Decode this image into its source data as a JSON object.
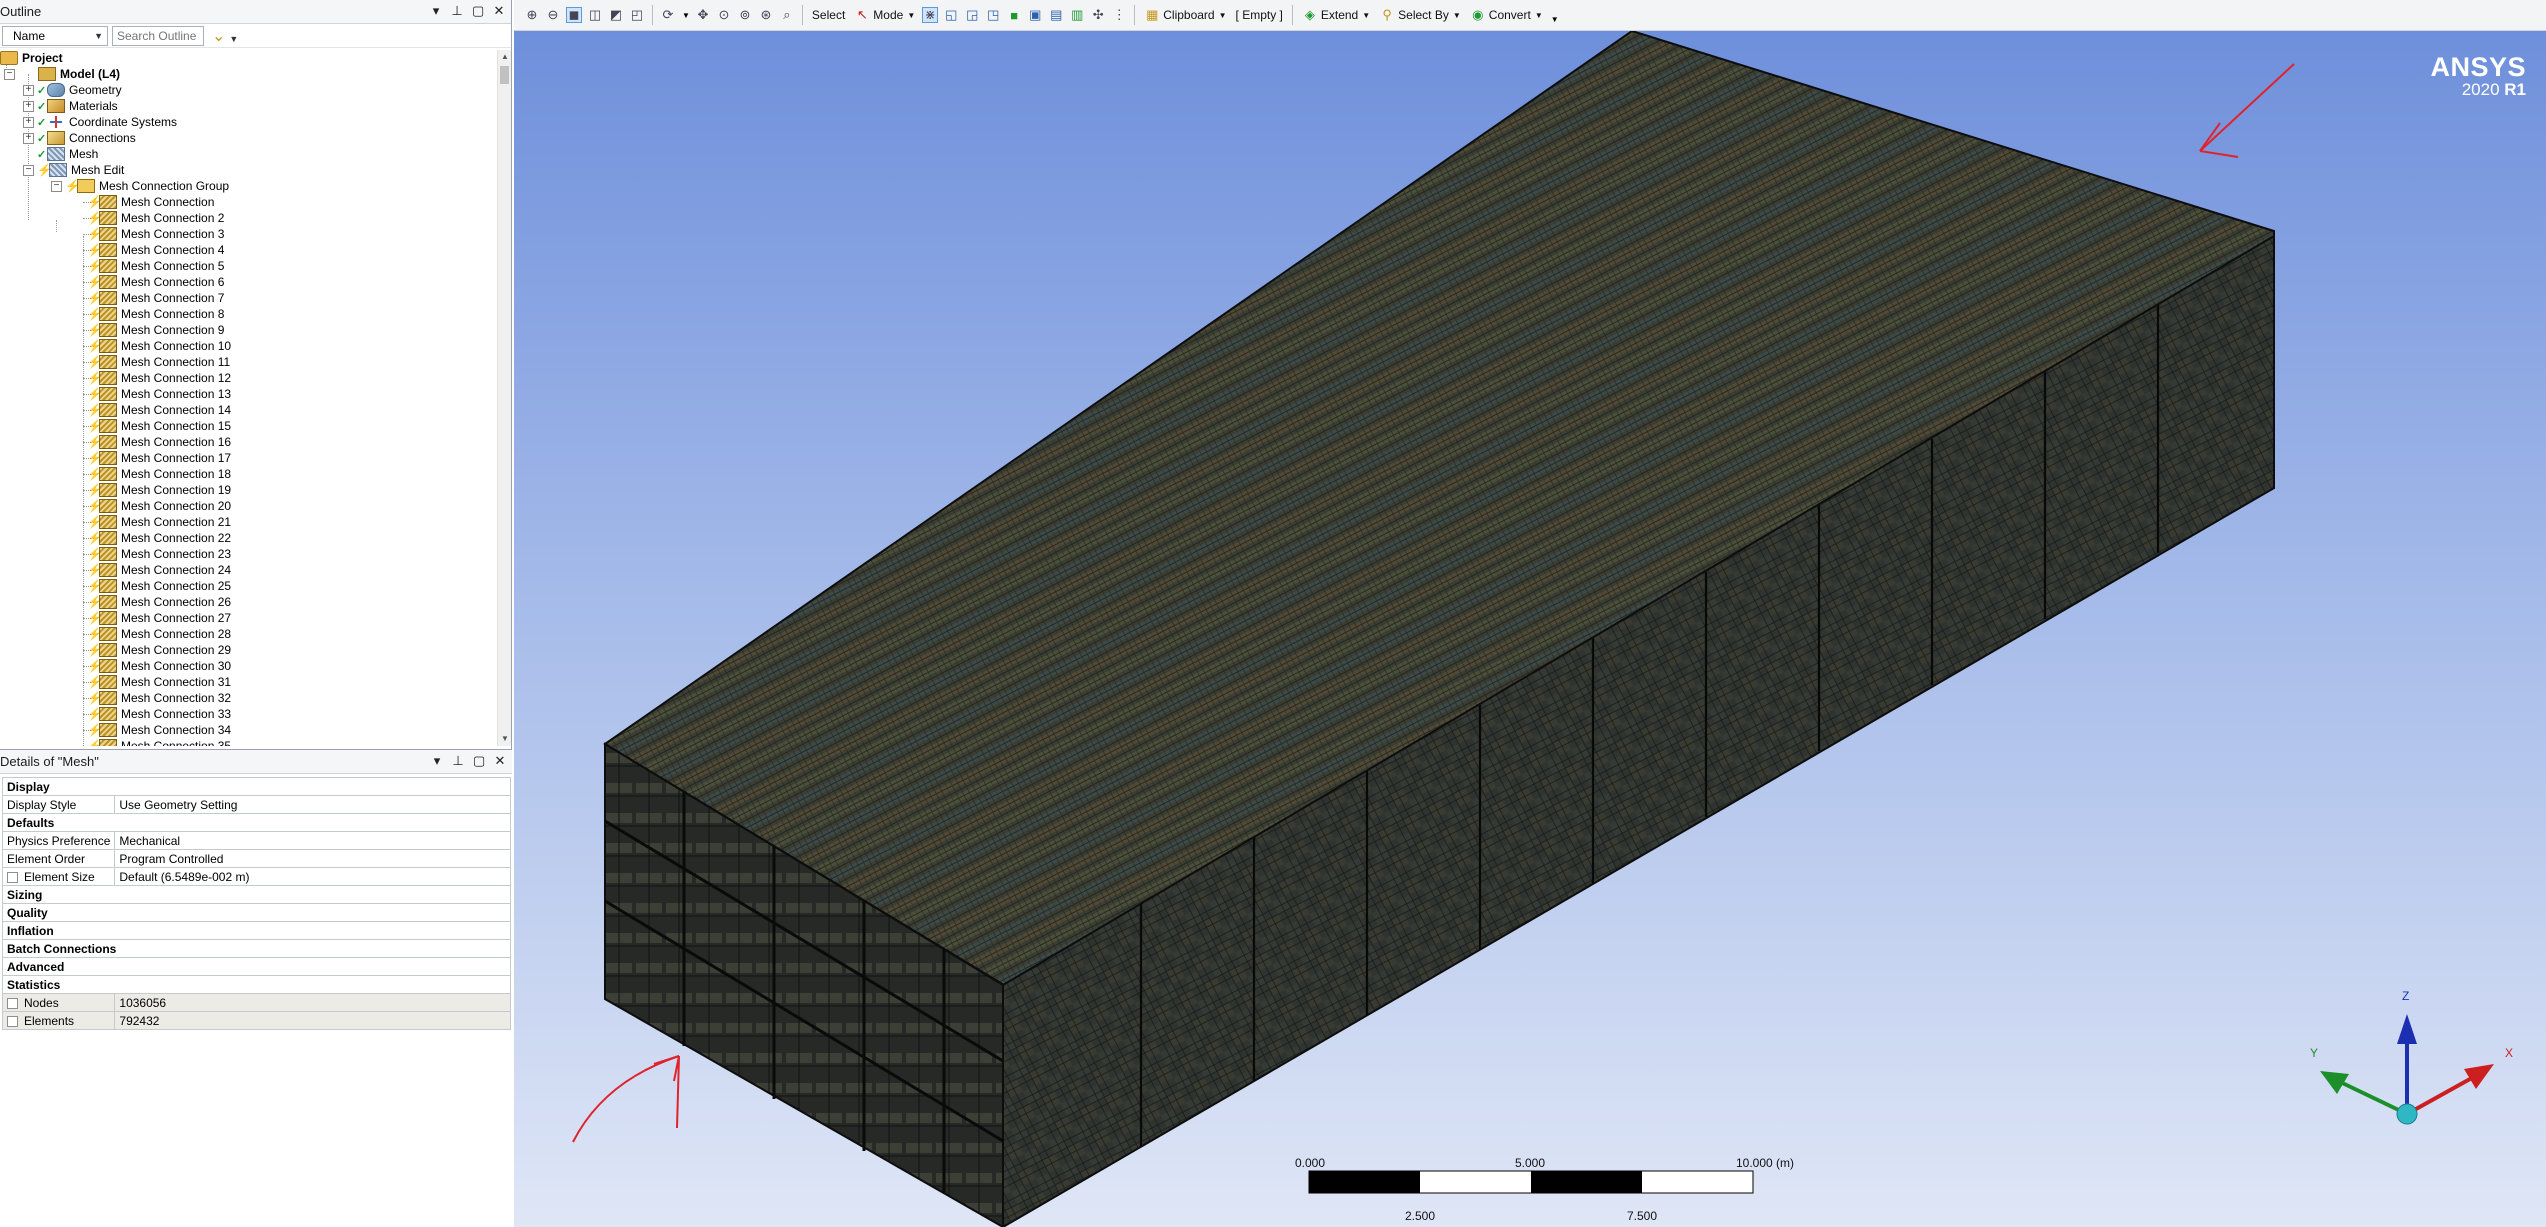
{
  "outline": {
    "title": "Outline",
    "filter_select": "Name",
    "search_placeholder": "Search Outline",
    "tree": {
      "project": "Project",
      "model": "Model (L4)",
      "geometry": "Geometry",
      "materials": "Materials",
      "coordinate_systems": "Coordinate Systems",
      "connections": "Connections",
      "mesh": "Mesh",
      "mesh_edit": "Mesh Edit",
      "mesh_connection_group": "Mesh Connection Group",
      "mesh_connections": [
        "Mesh Connection",
        "Mesh Connection 2",
        "Mesh Connection 3",
        "Mesh Connection 4",
        "Mesh Connection 5",
        "Mesh Connection 6",
        "Mesh Connection 7",
        "Mesh Connection 8",
        "Mesh Connection 9",
        "Mesh Connection 10",
        "Mesh Connection 11",
        "Mesh Connection 12",
        "Mesh Connection 13",
        "Mesh Connection 14",
        "Mesh Connection 15",
        "Mesh Connection 16",
        "Mesh Connection 17",
        "Mesh Connection 18",
        "Mesh Connection 19",
        "Mesh Connection 20",
        "Mesh Connection 21",
        "Mesh Connection 22",
        "Mesh Connection 23",
        "Mesh Connection 24",
        "Mesh Connection 25",
        "Mesh Connection 26",
        "Mesh Connection 27",
        "Mesh Connection 28",
        "Mesh Connection 29",
        "Mesh Connection 30",
        "Mesh Connection 31",
        "Mesh Connection 32",
        "Mesh Connection 33",
        "Mesh Connection 34",
        "Mesh Connection 35"
      ]
    }
  },
  "details": {
    "title": "Details of \"Mesh\"",
    "display_cat": "Display",
    "display_style_key": "Display Style",
    "display_style_val": "Use Geometry Setting",
    "defaults_cat": "Defaults",
    "physics_key": "Physics Preference",
    "physics_val": "Mechanical",
    "order_key": "Element Order",
    "order_val": "Program Controlled",
    "size_key": "Element Size",
    "size_val": "Default (6.5489e-002 m)",
    "sizing_cat": "Sizing",
    "quality_cat": "Quality",
    "inflation_cat": "Inflation",
    "batch_cat": "Batch Connections",
    "advanced_cat": "Advanced",
    "statistics_cat": "Statistics",
    "nodes_key": "Nodes",
    "nodes_val": "1036056",
    "elements_key": "Elements",
    "elements_val": "792432"
  },
  "toolbar": {
    "select": "Select",
    "mode": "Mode",
    "clipboard": "Clipboard",
    "empty": "[ Empty ]",
    "extend": "Extend",
    "select_by": "Select By",
    "convert": "Convert"
  },
  "viewport": {
    "brand_name": "ANSYS",
    "brand_version": "2020",
    "brand_release": "R1",
    "scale_labels_top": [
      "0.000",
      "5.000",
      "10.000 (m)"
    ],
    "scale_labels_bottom": [
      "2.500",
      "7.500"
    ],
    "triad": {
      "x": "X",
      "y": "Y",
      "z": "Z"
    },
    "colors": {
      "annotation": "#e0232b",
      "triad_x": "#cc1f1f",
      "triad_y": "#1d8f2a",
      "triad_z": "#1b2fb0",
      "triad_origin": "#2fb8c4"
    }
  }
}
